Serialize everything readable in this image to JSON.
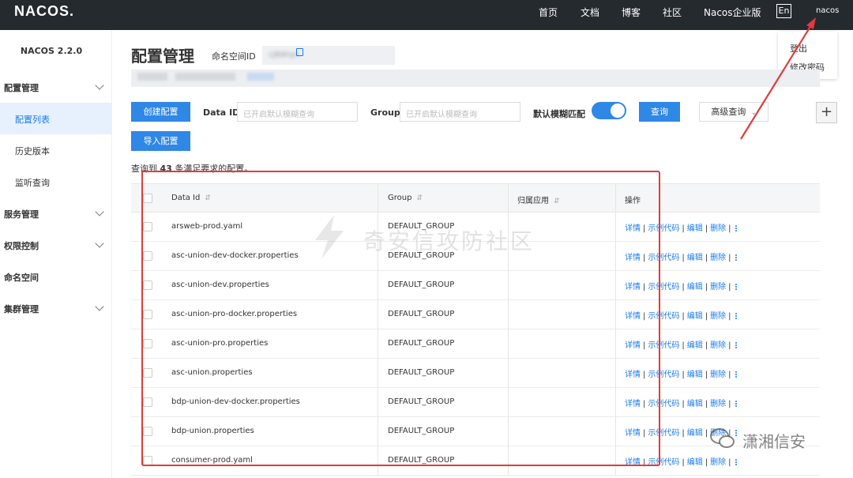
{
  "topbar": {
    "logo": "NACOS.",
    "nav": [
      "首页",
      "文档",
      "博客",
      "社区",
      "Nacos企业版"
    ],
    "lang": "En",
    "user": "nacos"
  },
  "user_menu": [
    "登出",
    "修改密码"
  ],
  "sidebar": {
    "version": "NACOS 2.2.0",
    "items": [
      {
        "label": "配置管理",
        "type": "group",
        "expandable": true
      },
      {
        "label": "配置列表",
        "type": "sub",
        "active": true
      },
      {
        "label": "历史版本",
        "type": "sub"
      },
      {
        "label": "监听查询",
        "type": "sub"
      },
      {
        "label": "服务管理",
        "type": "group",
        "expandable": true
      },
      {
        "label": "权限控制",
        "type": "group",
        "expandable": true
      },
      {
        "label": "命名空间",
        "type": "group",
        "expandable": false
      },
      {
        "label": "集群管理",
        "type": "group",
        "expandable": true
      }
    ]
  },
  "main": {
    "title": "配置管理",
    "namespace_label": "命名空间ID",
    "namespace_value": "cj8dnyv",
    "create_button": "创建配置",
    "import_button": "导入配置",
    "data_id_label": "Data ID",
    "data_id_placeholder": "已开启默认模糊查询",
    "group_label": "Group",
    "group_placeholder": "已开启默认模糊查询",
    "fuzzy_label": "默认模糊匹配",
    "fuzzy_enabled": true,
    "query_button": "查询",
    "advanced_button": "高级查询",
    "plus_button": "+",
    "count_prefix": "查询到",
    "count": "43",
    "count_suffix": "条满足要求的配置。"
  },
  "table": {
    "headers": [
      "Data Id",
      "Group",
      "归属应用",
      "操作"
    ],
    "rows": [
      {
        "data_id": "arsweb-prod.yaml",
        "group": "DEFAULT_GROUP",
        "app": ""
      },
      {
        "data_id": "asc-union-dev-docker.properties",
        "group": "DEFAULT_GROUP",
        "app": ""
      },
      {
        "data_id": "asc-union-dev.properties",
        "group": "DEFAULT_GROUP",
        "app": ""
      },
      {
        "data_id": "asc-union-pro-docker.properties",
        "group": "DEFAULT_GROUP",
        "app": ""
      },
      {
        "data_id": "asc-union-pro.properties",
        "group": "DEFAULT_GROUP",
        "app": ""
      },
      {
        "data_id": "asc-union.properties",
        "group": "DEFAULT_GROUP",
        "app": ""
      },
      {
        "data_id": "bdp-union-dev-docker.properties",
        "group": "DEFAULT_GROUP",
        "app": ""
      },
      {
        "data_id": "bdp-union.properties",
        "group": "DEFAULT_GROUP",
        "app": ""
      },
      {
        "data_id": "consumer-prod.yaml",
        "group": "DEFAULT_GROUP",
        "app": ""
      }
    ],
    "actions": [
      "详情",
      "示例代码",
      "编辑",
      "删除"
    ]
  },
  "watermark": {
    "center": "奇安信攻防社区",
    "corner": "潇湘信安"
  },
  "colors": {
    "topbar_bg": "#252a2f",
    "primary": "#2f87e6",
    "link": "#1a7cf0",
    "highlight": "#e23b3b"
  }
}
